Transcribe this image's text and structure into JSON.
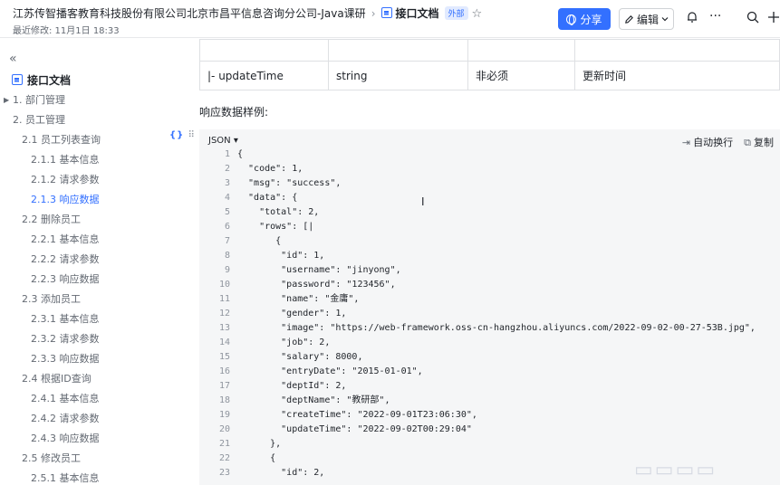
{
  "header": {
    "breadcrumb": "江苏传智播客教育科技股份有限公司北京市昌平信息咨询分公司-Java课研",
    "doc_title": "接口文档",
    "badge": "外部",
    "modified": "最近修改: 11月1日 18:33",
    "share_label": "分享",
    "edit_label": "编辑",
    "more_icon": "···",
    "star_icon": "☆",
    "bell_icon": "bell-icon",
    "search_icon": "search-icon",
    "add_icon": "plus-icon"
  },
  "sidebar": {
    "collapse_icon": "«",
    "title": "接口文档",
    "items": [
      {
        "label": "1. 部门管理"
      },
      {
        "label": "2. 员工管理"
      },
      {
        "label": "2.1 员工列表查询"
      },
      {
        "label": "2.1.1 基本信息"
      },
      {
        "label": "2.1.2 请求参数"
      },
      {
        "label": "2.1.3 响应数据"
      },
      {
        "label": "2.2 删除员工"
      },
      {
        "label": "2.2.1 基本信息"
      },
      {
        "label": "2.2.2 请求参数"
      },
      {
        "label": "2.2.3 响应数据"
      },
      {
        "label": "2.3 添加员工"
      },
      {
        "label": "2.3.1 基本信息"
      },
      {
        "label": "2.3.2 请求参数"
      },
      {
        "label": "2.3.3 响应数据"
      },
      {
        "label": "2.4 根据ID查询"
      },
      {
        "label": "2.4.1 基本信息"
      },
      {
        "label": "2.4.2 请求参数"
      },
      {
        "label": "2.4.3 响应数据"
      },
      {
        "label": "2.5 修改员工"
      },
      {
        "label": "2.5.1 基本信息"
      }
    ],
    "float_tools": "{}",
    "drag_handle": "⠿"
  },
  "main": {
    "table_row": {
      "name": "|- updateTime",
      "type": "string",
      "required": "非必须",
      "desc": "更新时间"
    },
    "response_label": "响应数据样例:",
    "code": {
      "lang": "JSON",
      "wrap_label": "自动换行",
      "copy_label": "复制",
      "lines": [
        "{",
        "  \"code\": 1,",
        "  \"msg\": \"success\",",
        "  \"data\": {",
        "    \"total\": 2,",
        "    \"rows\": [|",
        "       {",
        "        \"id\": 1,",
        "        \"username\": \"jinyong\",",
        "        \"password\": \"123456\",",
        "        \"name\": \"金庸\",",
        "        \"gender\": 1,",
        "        \"image\": \"https://web-framework.oss-cn-hangzhou.aliyuncs.com/2022-09-02-00-27-53B.jpg\",",
        "        \"job\": 2,",
        "        \"salary\": 8000,",
        "        \"entryDate\": \"2015-01-01\",",
        "        \"deptId\": 2,",
        "        \"deptName\": \"教研部\",",
        "        \"createTime\": \"2022-09-01T23:06:30\",",
        "        \"updateTime\": \"2022-09-02T00:29:04\"",
        "      },",
        "      {",
        "        \"id\": 2,"
      ]
    }
  }
}
